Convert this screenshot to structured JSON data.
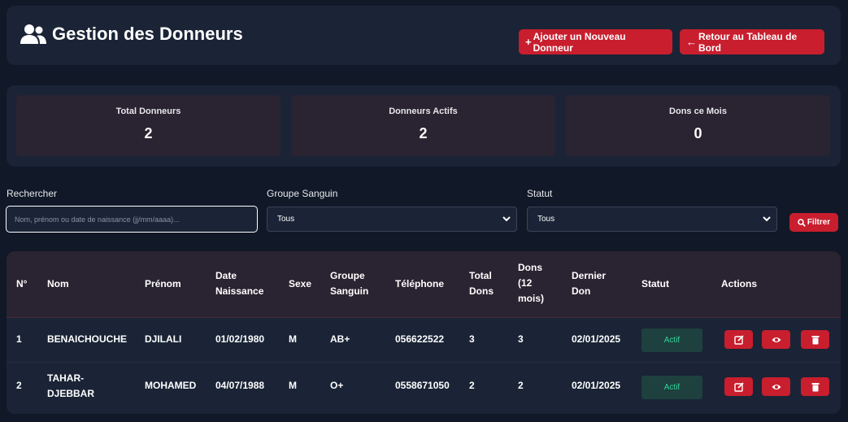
{
  "header": {
    "title": "Gestion des Donneurs",
    "add_label": "Ajouter un Nouveau Donneur",
    "back_label": "Retour au Tableau de Bord"
  },
  "stats": [
    {
      "label": "Total Donneurs",
      "value": "2"
    },
    {
      "label": "Donneurs Actifs",
      "value": "2"
    },
    {
      "label": "Dons ce Mois",
      "value": "0"
    }
  ],
  "filters": {
    "search_label": "Rechercher",
    "search_placeholder": "Nom, prénom ou date de naissance (jj/mm/aaaa)...",
    "blood_label": "Groupe Sanguin",
    "blood_value": "Tous",
    "status_label": "Statut",
    "status_value": "Tous",
    "filter_button": "Filtrer"
  },
  "table": {
    "headers": [
      "N°",
      "Nom",
      "Prénom",
      "Date Naissance",
      "Sexe",
      "Groupe Sanguin",
      "Téléphone",
      "Total Dons",
      "Dons (12 mois)",
      "Dernier Don",
      "Statut",
      "Actions"
    ],
    "rows": [
      {
        "num": "1",
        "nom": "BENAICHOUCHE",
        "prenom": "DJILALI",
        "naissance": "01/02/1980",
        "sexe": "M",
        "groupe": "AB+",
        "telephone": "056622522",
        "total": "3",
        "dons12": "3",
        "dernier": "02/01/2025",
        "statut": "Actif"
      },
      {
        "num": "2",
        "nom": "TAHAR-DJEBBAR",
        "prenom": "MOHAMED",
        "naissance": "04/07/1988",
        "sexe": "M",
        "groupe": "O+",
        "telephone": "0558671050",
        "total": "2",
        "dons12": "2",
        "dernier": "02/01/2025",
        "statut": "Actif"
      }
    ]
  },
  "colors": {
    "accent": "#c81e2e",
    "panel": "#1a2436",
    "background": "#111827",
    "active": "#34d399"
  },
  "icons": [
    "users-icon",
    "plus-icon",
    "arrow-left-icon",
    "search-icon",
    "chevron-down-icon",
    "edit-icon",
    "eye-icon",
    "trash-icon"
  ]
}
